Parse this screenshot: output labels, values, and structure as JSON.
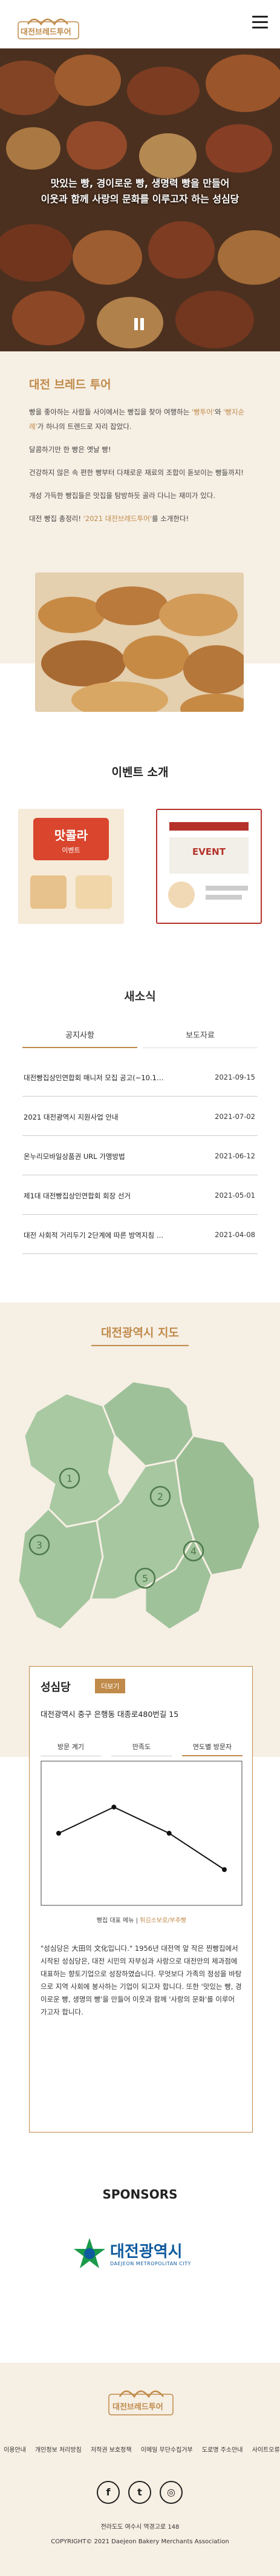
{
  "header": {
    "logo_text": "대전브레드투어",
    "menu_icon": "hamburger-menu-icon"
  },
  "hero": {
    "line1": "맛있는 빵, 경이로운 빵, 생명력 빵을 만들어",
    "line2": "이웃과 함께 사랑의 문화를 이루고자 하는 성심당",
    "pause_icon": "pause-icon"
  },
  "about": {
    "title": "대전 브레드 투어",
    "p1": "빵을 좋아하는 사람들 사이에서는 빵집을 찾아 여행하는",
    "p1_hl1": "'빵투어'",
    "p1_mid": "와",
    "p1_hl2": "'빵지순례'",
    "p1_end": "가 하나의 트렌드로 자리 잡았다.",
    "p2": "달콤하기만 한 빵은 옛날 빵!",
    "p3": "건강하지 않은 속 편한 빵부터 다채로운 재료의 조합이 돋보이는 빵들까지!",
    "p4": "개성 가득한 빵집들은 맛집을 탐방하듯 골라 다니는 재미가 있다.",
    "p5_start": "대전 빵집 총정리!",
    "p5_hl": "'2021 대전브레드투어'",
    "p5_end": "를 소개한다!"
  },
  "events": {
    "title": "이벤트 소개",
    "card1_label": "맛콜라",
    "card1_sub": "이벤트",
    "card2_label": "EVENT"
  },
  "news": {
    "title": "새소식",
    "tabs": [
      "공지사항",
      "보도자료"
    ],
    "rows": [
      {
        "title": "대전빵집상인연합회 매니저 모집 공고(~10.1…",
        "date": "2021-09-15"
      },
      {
        "title": "2021 대전광역시 지원사업 안내",
        "date": "2021-07-02"
      },
      {
        "title": "온누리모바일상품권 URL 가맹방법",
        "date": "2021-06-12"
      },
      {
        "title": "제1대 대전빵집상인연합회 회장 선거",
        "date": "2021-05-01"
      },
      {
        "title": "대전 사회적 거리두기 2단계에 따른 방역지침 …",
        "date": "2021-04-08"
      }
    ]
  },
  "map": {
    "title": "대전광역시 지도",
    "markers": [
      "1",
      "2",
      "3",
      "4",
      "5"
    ]
  },
  "detail": {
    "name": "성심당",
    "more_label": "더보기",
    "address": "대전광역시 중구 은행동 대종로480번길 15",
    "tabs": [
      "방문 계기",
      "만족도",
      "연도별 방문자"
    ],
    "legend_prefix": "빵집 대표 메뉴",
    "legend_items": "튀김소보로/부추빵",
    "description": "\"성심당은 大田의 文化입니다.\" 1956년 대전역 앞 작은 찐빵집에서 시작된 성심당은, 대전 시민의 자부심과 사랑으로 대전만의 제과점에 대표하는 향토기업으로 성장하였습니다. 무엇보다 가족의 정성을 바탕으로 지역 사회에 봉사하는 기업이 되고자 합니다. 또한 '맛있는 빵, 경이로운 빵, 생명의 빵'을 만들어 이웃과 함께 '사랑의 문화'를 이루어 가고자 합니다.",
    "chart_points": [
      0.5,
      0.68,
      0.5,
      0.25
    ]
  },
  "sponsors": {
    "title": "SPONSORS",
    "sponsor_name": "대전광역시",
    "sponsor_sub": "DAEJEON METROPOLITAN CITY"
  },
  "footer": {
    "logo_text": "대전브레드투어",
    "links": [
      "이용안내",
      "개인정보 처리방침",
      "저작권 보호정책",
      "이메일 무단수집거부",
      "도로명 주소안내",
      "사이트오류 신고"
    ],
    "social": [
      "facebook-icon",
      "twitter-icon",
      "instagram-icon"
    ],
    "address": "전라도도 여수시 역경고로 148",
    "copyright": "COPYRIGHT© 2021 Daejeon Bakery Merchants Association"
  },
  "colors": {
    "accent": "#c08a4a",
    "cream": "#f6efe4",
    "map_green": "#9fc19a"
  }
}
